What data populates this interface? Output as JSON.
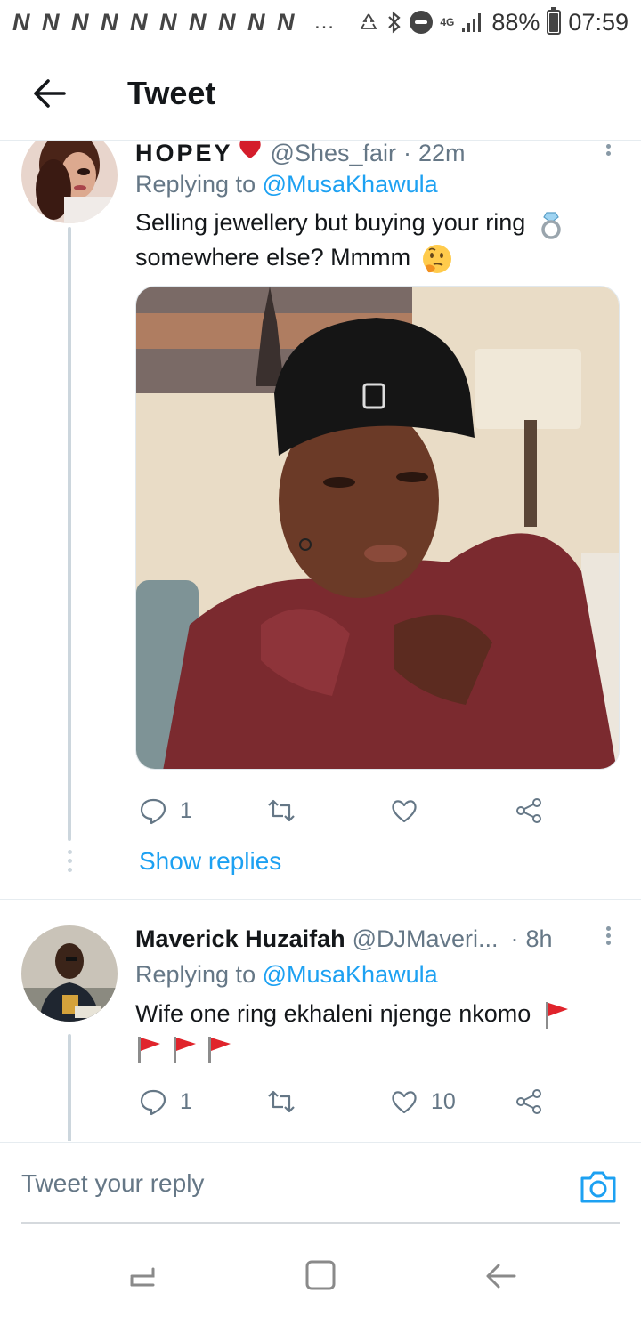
{
  "status_bar": {
    "notification_icons": [
      "N",
      "N",
      "N",
      "N",
      "N",
      "N",
      "N",
      "N",
      "N",
      "N"
    ],
    "more": "…",
    "network": "4G",
    "battery": "88%",
    "battery_level": 0.88,
    "time": "07:59"
  },
  "header": {
    "title": "Tweet",
    "back_icon": "back-arrow-icon"
  },
  "tweets": [
    {
      "display_name": "HOPEY",
      "name_emoji": "heart-icon",
      "handle": "@Shes_fair",
      "separator": "·",
      "time": "22m",
      "replying_prefix": "Replying to",
      "replying_to": "@MusaKhawula",
      "text_line1": "Selling jewellery but buying your ring",
      "text_line2": "somewhere else? Mmmm",
      "emojis": [
        "ring-icon",
        "thinking-face-icon"
      ],
      "media": "image-of-man-in-black-cap-hugging-himself",
      "reply_count": "1",
      "retweet_count": "",
      "like_count": "",
      "show_replies": "Show replies"
    },
    {
      "display_name": "Maverick Huzaifah",
      "handle": "@DJMaveri...",
      "separator": "·",
      "time": "8h",
      "replying_prefix": "Replying to",
      "replying_to": "@MusaKhawula",
      "text_line1": "Wife one ring ekhaleni njenge nkomo",
      "emojis": [
        "red-flag-icon",
        "red-flag-icon",
        "red-flag-icon",
        "red-flag-icon"
      ],
      "reply_count": "1",
      "retweet_count": "",
      "like_count": "10"
    }
  ],
  "reply_bar": {
    "placeholder": "Tweet your reply",
    "camera_icon": "camera-icon"
  },
  "navigation": {
    "recents_icon": "recents-icon",
    "home_icon": "home-icon",
    "back_icon": "nav-back-icon"
  },
  "colors": {
    "accent": "#1da1f2",
    "secondary_text": "#657786",
    "primary_text": "#14171a",
    "divider": "#e6ecf0",
    "flag_red": "#e0242c"
  }
}
